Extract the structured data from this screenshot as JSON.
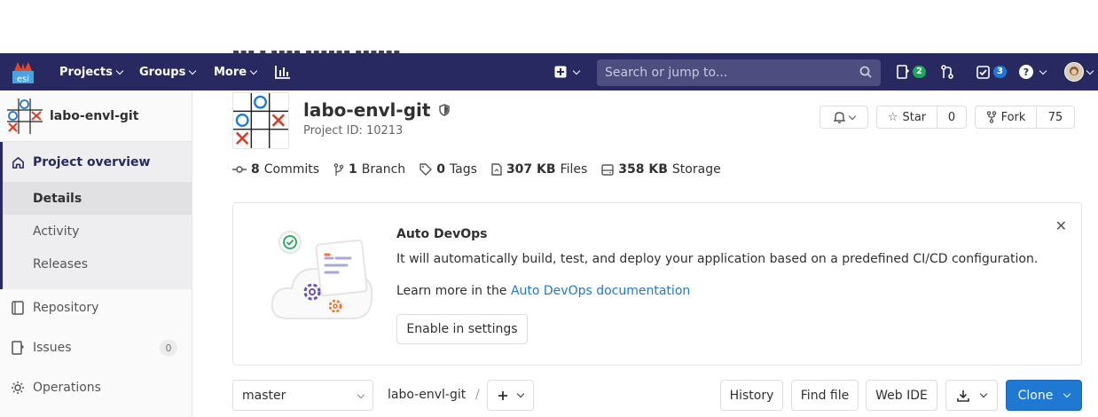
{
  "nav": {
    "projects": "Projects",
    "groups": "Groups",
    "more": "More",
    "search_placeholder": "Search or jump to...",
    "todos_count": "2",
    "issues_count": "3"
  },
  "sidebar": {
    "project_name": "labo-envl-git",
    "overview": "Project overview",
    "details": "Details",
    "activity": "Activity",
    "releases": "Releases",
    "repository": "Repository",
    "issues": "Issues",
    "issues_count": "0",
    "operations": "Operations"
  },
  "project": {
    "name": "labo-envl-git",
    "id_text": "Project ID: 10213",
    "star_label": "Star",
    "star_count": "0",
    "fork_label": "Fork",
    "fork_count": "75",
    "stats": {
      "commits_num": "8",
      "commits_label": "Commits",
      "branch_num": "1",
      "branch_label": "Branch",
      "tags_num": "0",
      "tags_label": "Tags",
      "files_num": "307 KB",
      "files_label": "Files",
      "storage_num": "358 KB",
      "storage_label": "Storage"
    }
  },
  "devops": {
    "title": "Auto DevOps",
    "text": "It will automatically build, test, and deploy your application based on a predefined CI/CD configuration.",
    "learn_prefix": "Learn more in the",
    "learn_link": "Auto DevOps documentation",
    "button": "Enable in settings"
  },
  "repo_bar": {
    "branch": "master",
    "path": "labo-envl-git",
    "separator": "/",
    "history": "History",
    "find_file": "Find file",
    "web_ide": "Web IDE",
    "clone": "Clone"
  },
  "colors": {
    "navbar": "#292961",
    "link": "#1f78d1",
    "clone_button": "#1f78d1",
    "todo_badge": "#1aaa55",
    "issue_badge": "#1f78d1"
  }
}
